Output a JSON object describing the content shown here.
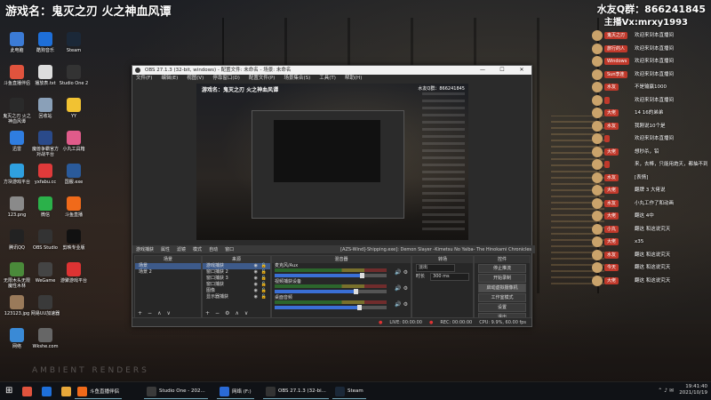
{
  "overlay": {
    "title": "游戏名：鬼灭之刃 火之神血风谭",
    "qq": "水友Q群：866241845",
    "vx": "主播Vx:mrxy1993",
    "ambient": "AMBIENT RENDERS"
  },
  "desktop_icons": [
    {
      "label": "此电脑",
      "color": "#3b7bd6"
    },
    {
      "label": "斗鱼直播伴侣",
      "color": "#e0533d"
    },
    {
      "label": "鬼灭之刃 火之神血风谭",
      "color": "#2a2a2a"
    },
    {
      "label": "迅雷",
      "color": "#2f7de0"
    },
    {
      "label": "方块游戏平台",
      "color": "#2fa0e0"
    },
    {
      "label": "123.png",
      "color": "#8a8a8a"
    },
    {
      "label": "腾讯QQ",
      "color": "#222"
    },
    {
      "label": "无限木头无限魔性木林",
      "color": "#4a8a3a"
    },
    {
      "label": "123123.jpg",
      "color": "#9a7a5a"
    },
    {
      "label": "网络",
      "color": "#3a8ad6"
    },
    {
      "label": "酷狗音乐",
      "color": "#1e6fd9"
    },
    {
      "label": "播放表.txt",
      "color": "#ddd"
    },
    {
      "label": "回收站",
      "color": "#8aa0b8"
    },
    {
      "label": "魔兽争霸官方对战平台",
      "color": "#2a4a8a"
    },
    {
      "label": "yxfabu.cc",
      "color": "#e03a3a"
    },
    {
      "label": "微信",
      "color": "#2bb14a"
    },
    {
      "label": "OBS Studio",
      "color": "#333"
    },
    {
      "label": "WeGame",
      "color": "#444"
    },
    {
      "label": "网易UU加速器",
      "color": "#3a3a3a"
    },
    {
      "label": "Wkshe.com",
      "color": "#666"
    },
    {
      "label": "Steam",
      "color": "#1b2838"
    },
    {
      "label": "Studio One 2",
      "color": "#333"
    },
    {
      "label": "YY",
      "color": "#f1c232"
    },
    {
      "label": "小丸工具箱",
      "color": "#e05b8a"
    },
    {
      "label": "国服.exe",
      "color": "#2a5a9a"
    },
    {
      "label": "斗鱼直播",
      "color": "#f06a1a"
    },
    {
      "label": "剪映专业版",
      "color": "#111"
    },
    {
      "label": "游聚游戏平台",
      "color": "#d33"
    }
  ],
  "chat": [
    {
      "user": "鬼灭之刃",
      "text": "欢迎来到本直播间"
    },
    {
      "user": "旅行的人",
      "text": "欢迎来到本直播间"
    },
    {
      "user": "Windows",
      "text": "欢迎来到本直播间"
    },
    {
      "user": "Sun李连",
      "text": "欢迎来到本直播间"
    },
    {
      "user": "水友",
      "text": "不是输赢1000"
    },
    {
      "user": "",
      "text": "欢迎来到本直播间"
    },
    {
      "user": "大佬",
      "text": "14 16的弟弟"
    },
    {
      "user": "水友",
      "text": "我刚说10个是"
    },
    {
      "user": "",
      "text": "欢迎来到本直播间"
    },
    {
      "user": "大佬",
      "text": "想秒杀，铅"
    },
    {
      "user": "",
      "text": "来，去棒，只能用炮天，都抽不到"
    },
    {
      "user": "水友",
      "text": "[表情]"
    },
    {
      "user": "大佬",
      "text": "翻牌 3 大佬说"
    },
    {
      "user": "水友",
      "text": "小丸工作了和动画"
    },
    {
      "user": "大佬",
      "text": "翻这 4中"
    },
    {
      "user": "小丸",
      "text": "翻这 和这说究天"
    },
    {
      "user": "大佬",
      "text": "x35"
    },
    {
      "user": "水友",
      "text": "翻这 和这说究天"
    },
    {
      "user": "今天",
      "text": "翻这 和这说究天"
    },
    {
      "user": "大佬",
      "text": "翻这 和这说究天"
    }
  ],
  "obs": {
    "title": "OBS 27.1.3 (32-bit, windows) - 配置文件: 未命名 - 场景: 未命名",
    "menu": [
      "文件(F)",
      "编辑(E)",
      "视图(V)",
      "停靠窗口(D)",
      "配置文件(P)",
      "场景集合(S)",
      "工具(T)",
      "帮助(H)"
    ],
    "window_buttons": [
      "—",
      "☐",
      "✕"
    ],
    "preview_title": "游戏名：鬼灭之刃 火之神血风谭",
    "preview_qq": "水友Q群：866241845",
    "info": {
      "source": "游戏捕获",
      "props": "属性",
      "filters": "滤镜",
      "mode": "模式",
      "auto": "自动",
      "window": "窗口",
      "media": "[AZS-Wind]-Shipping.exe]: Demon Slayer -Kimetsu No Yaiba- The Hinokami Chronicles"
    },
    "scenes": {
      "header": "场景",
      "items": [
        "场景",
        "场景 2"
      ]
    },
    "sources": {
      "header": "来源",
      "items": [
        "游戏捕获",
        "窗口捕获 2",
        "窗口捕获 3",
        "窗口捕获",
        "图像",
        "显示器捕获"
      ]
    },
    "mixer": {
      "header": "混音器",
      "tracks": [
        {
          "name": "麦克风/Aux",
          "level": 0.78
        },
        {
          "name": "视频捕获设备",
          "level": 0.72
        },
        {
          "name": "桌面音频",
          "level": 0.75
        }
      ]
    },
    "transitions": {
      "header": "转场",
      "type": "淡出",
      "duration_label": "时长",
      "duration": "300 ms"
    },
    "controls": {
      "header": "控件",
      "buttons": [
        "停止推流",
        "开始录制",
        "启动虚拟摄像机",
        "工作室模式",
        "设置",
        "退出"
      ]
    },
    "status": {
      "live": "LIVE: 00:00:00",
      "rec": "REC: 00:00:00",
      "cpu": "CPU: 9.9%, 60.00 fps"
    }
  },
  "taskbar": {
    "items": [
      {
        "label": "",
        "color": "#e0533d"
      },
      {
        "label": "",
        "color": "#1e6fd9"
      },
      {
        "label": "",
        "color": "#e8a83a"
      },
      {
        "label": "斗鱼直播伴侣",
        "color": "#f06a1a"
      },
      {
        "label": "Studio One - 202...",
        "color": "#3a3a3a"
      },
      {
        "label": "网络 (F:)",
        "color": "#2a6ad6"
      },
      {
        "label": "OBS 27.1.3 (32-bi...",
        "color": "#333"
      },
      {
        "label": "Steam",
        "color": "#1b2838"
      }
    ],
    "time": "19:41:40",
    "date": "2021/10/19"
  }
}
